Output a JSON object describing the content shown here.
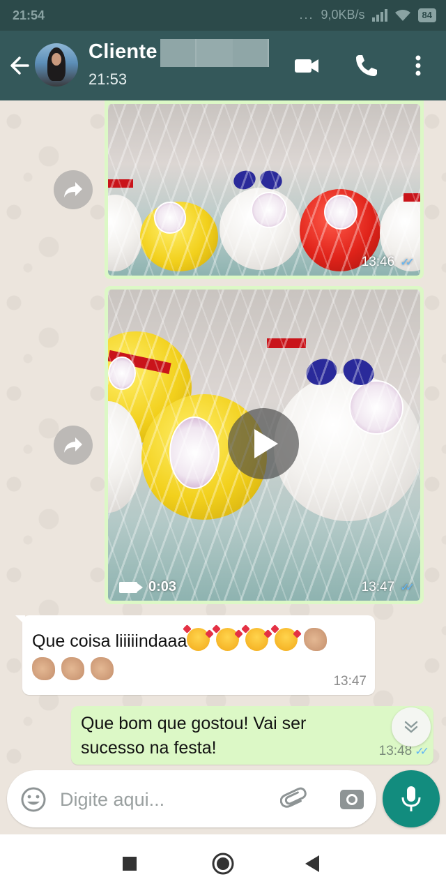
{
  "status_bar": {
    "time": "21:54",
    "dots": "...",
    "network_speed": "9,0KB/s",
    "battery": "84"
  },
  "header": {
    "contact_name": "Cliente",
    "last_seen": "21:53"
  },
  "messages": [
    {
      "type": "image",
      "direction": "out",
      "time": "13:46"
    },
    {
      "type": "video",
      "direction": "out",
      "duration": "0:03",
      "time": "13:47"
    },
    {
      "type": "text",
      "direction": "in",
      "text": "Que coisa liiiiindaaa",
      "time": "13:47"
    },
    {
      "type": "text",
      "direction": "out",
      "text_line1": "Que bom que gostou! Vai ser",
      "text_line2": "sucesso na festa!",
      "time": "13:48"
    }
  ],
  "compose": {
    "placeholder": "Digite aqui..."
  },
  "colors": {
    "header": "#34585a",
    "status_bar": "#2c4a4a",
    "outgoing_bubble": "#dcf8c6",
    "incoming_bubble": "#ffffff",
    "chat_background": "#ece5dd",
    "mic_button": "#128c7e",
    "read_ticks": "#62b6f5"
  },
  "icons": [
    "back-arrow-icon",
    "video-call-icon",
    "phone-icon",
    "more-vertical-icon",
    "forward-icon",
    "play-icon",
    "videocam-icon",
    "double-check-icon",
    "chevron-double-down-icon",
    "emoji-icon",
    "paperclip-icon",
    "camera-icon",
    "mic-icon",
    "nav-recents-icon",
    "nav-home-icon",
    "nav-back-icon"
  ]
}
